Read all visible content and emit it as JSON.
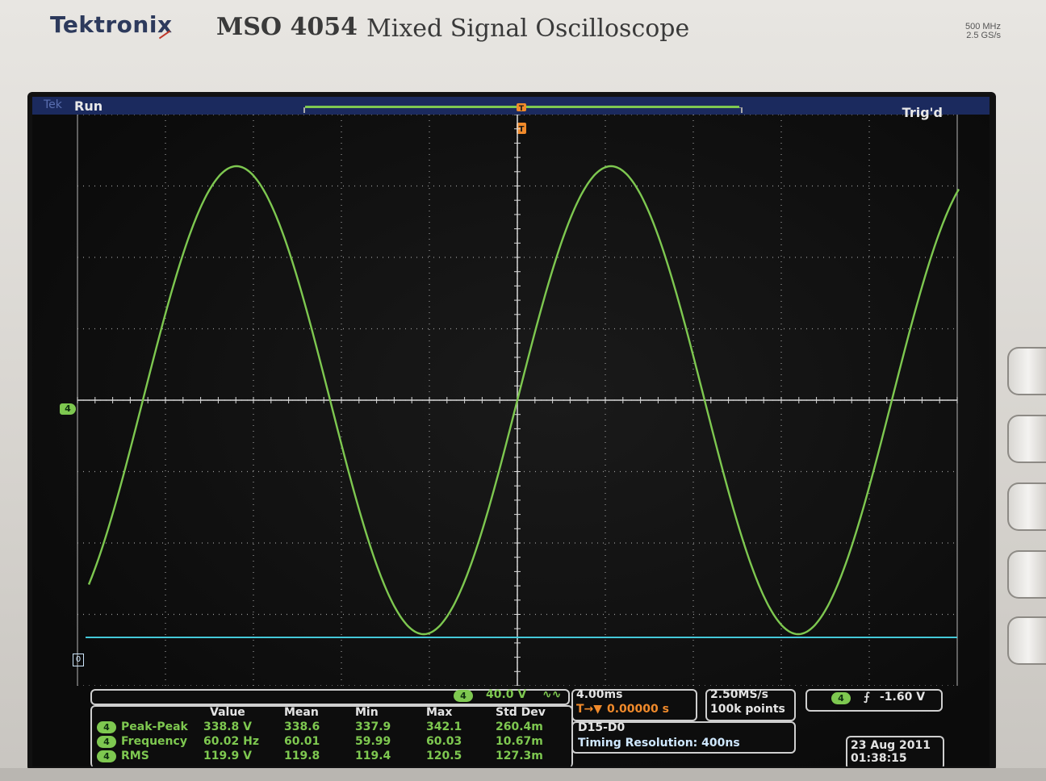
{
  "header": {
    "brand": "Tektronix",
    "model": "MSO 4054",
    "subtitle": "Mixed Signal Oscilloscope",
    "spec_bandwidth": "500 MHz",
    "spec_rate": "2.5 GS/s"
  },
  "status": {
    "tek": "Tek",
    "run_state": "Run",
    "trigger_state": "Trig'd",
    "trigger_marker": "T"
  },
  "channel": {
    "marker": "4",
    "digital_marker": "0",
    "color": "#7ec850"
  },
  "readout": {
    "channel_badge": "4",
    "scale": "40.0 V",
    "coupling_symbol": "∿∿",
    "timebase": "4.00ms",
    "trigger_position_symbol": "T→▼",
    "trigger_position": "0.00000 s",
    "sample_rate": "2.50MS/s",
    "record_length": "100k points",
    "trigger_channel": "4",
    "trigger_slope_symbol": "⨍",
    "trigger_level": "-1.60 V",
    "digital_bus": "D15-D0",
    "timing_resolution": "Timing Resolution: 400ns",
    "date": "23 Aug 2011",
    "time": "01:38:15"
  },
  "measurements": {
    "headers": [
      "Value",
      "Mean",
      "Min",
      "Max",
      "Std Dev"
    ],
    "rows": [
      {
        "badge": "4",
        "name": "Peak-Peak",
        "values": [
          "338.8 V",
          "338.6",
          "337.9",
          "342.1",
          "260.4m"
        ]
      },
      {
        "badge": "4",
        "name": "Frequency",
        "values": [
          "60.02 Hz",
          "60.01",
          "59.99",
          "60.03",
          "10.67m"
        ]
      },
      {
        "badge": "4",
        "name": "RMS",
        "values": [
          "119.9 V",
          "119.8",
          "119.4",
          "120.5",
          "127.3m"
        ]
      }
    ]
  },
  "chart_data": {
    "type": "line",
    "grid": true,
    "series": [
      {
        "color": "#7ec850",
        "shape": "sine",
        "cycles_visible": 2.4,
        "phase_at_center": "rising-zero-crossing"
      }
    ]
  }
}
